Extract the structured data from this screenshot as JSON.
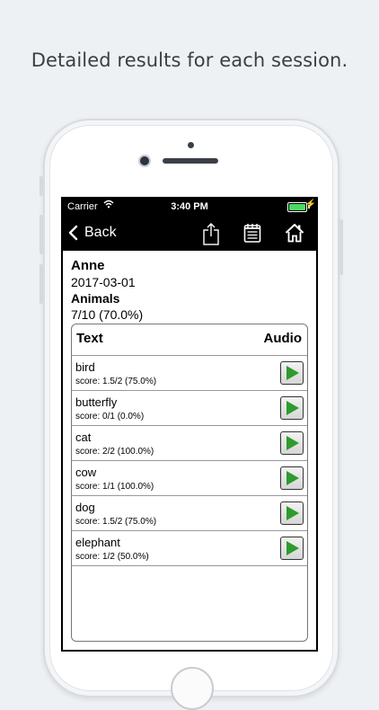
{
  "caption": "Detailed results for each session.",
  "status_bar": {
    "carrier": "Carrier",
    "time": "3:40 PM"
  },
  "nav": {
    "back_label": "Back"
  },
  "session": {
    "name": "Anne",
    "date": "2017-03-01",
    "category": "Animals",
    "overall": "7/10 (70.0%)"
  },
  "table": {
    "col_text": "Text",
    "col_audio": "Audio",
    "rows": [
      {
        "word": "bird",
        "score": "score: 1.5/2 (75.0%)"
      },
      {
        "word": "butterfly",
        "score": "score: 0/1 (0.0%)"
      },
      {
        "word": "cat",
        "score": "score: 2/2 (100.0%)"
      },
      {
        "word": "cow",
        "score": "score: 1/1 (100.0%)"
      },
      {
        "word": "dog",
        "score": "score: 1.5/2 (75.0%)"
      },
      {
        "word": "elephant",
        "score": "score: 1/2 (50.0%)"
      }
    ]
  },
  "icons": [
    "wifi-icon",
    "share-icon",
    "notepad-icon",
    "home-icon",
    "play-icon",
    "back-chevron-icon",
    "battery-icon"
  ],
  "colors": {
    "play_accent": "#2e9b2e",
    "battery": "#4cd964",
    "navbar": "#000000"
  }
}
